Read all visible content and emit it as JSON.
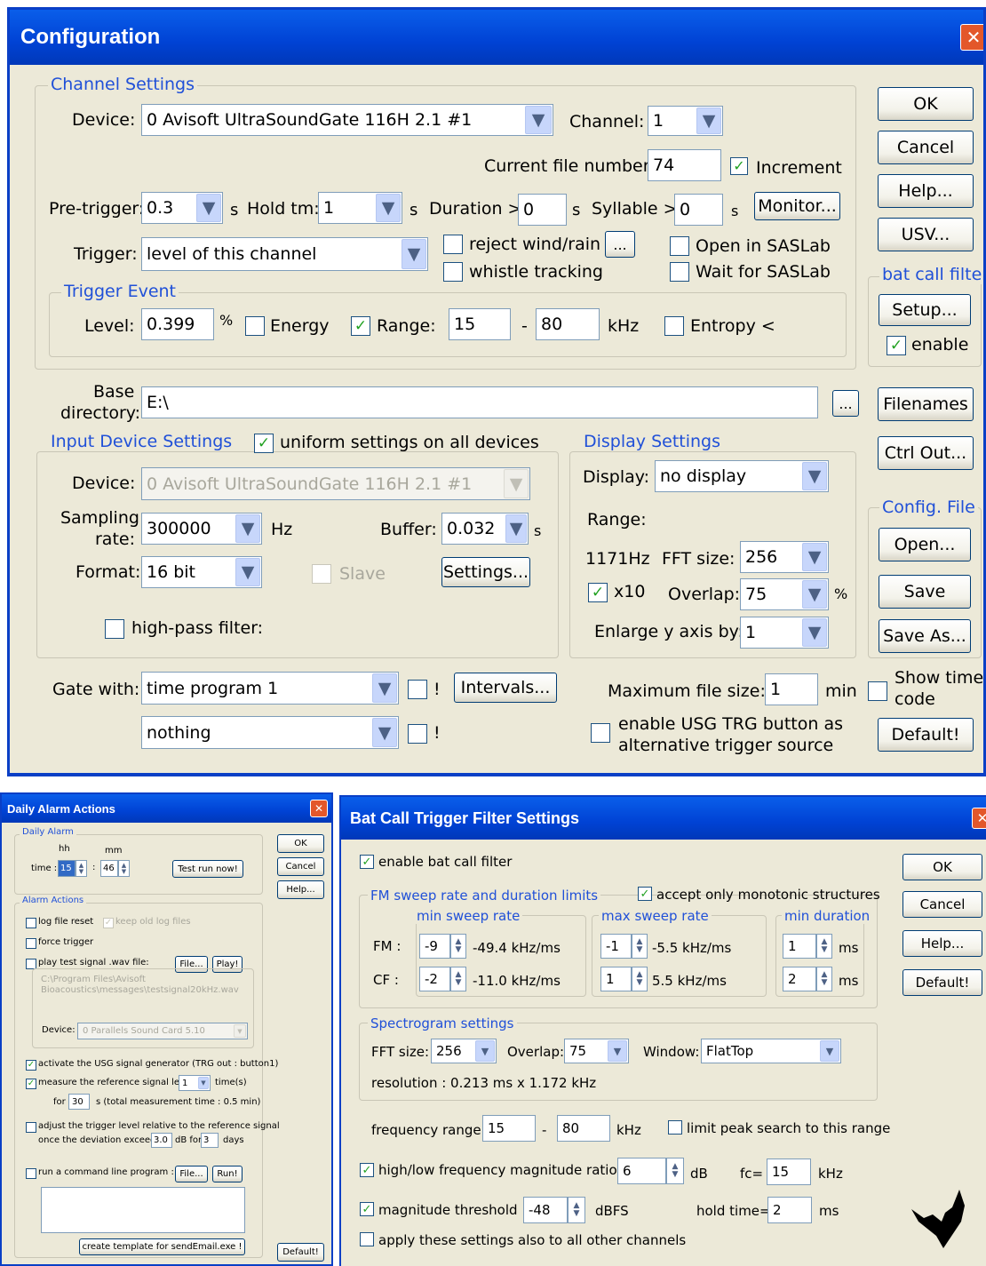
{
  "config": {
    "title": "Configuration",
    "close": "✕",
    "channel": {
      "legend": "Channel Settings",
      "device_label": "Device:",
      "device_value": "0 Avisoft UltraSoundGate 116H 2.1 #1",
      "channel_label": "Channel:",
      "channel_value": "1",
      "file_number_label": "Current file number:",
      "file_number_value": "74",
      "increment_label": "Increment",
      "pretrigger_label": "Pre-trigger:",
      "pretrigger_value": "0.3",
      "s": "s",
      "hold_label": "Hold tm:",
      "hold_value": "1",
      "duration_label": "Duration >",
      "duration_value": "0",
      "syllable_label": "Syllable >",
      "syllable_value": "0",
      "monitor_label": "Monitor...",
      "trigger_label": "Trigger:",
      "trigger_value": "level of this channel",
      "reject_label": "reject wind/rain",
      "dots": "...",
      "whistle_label": "whistle tracking",
      "open_saslab_label": "Open in SASLab",
      "wait_saslab_label": "Wait for SASLab"
    },
    "trigger_event": {
      "legend": "Trigger Event",
      "level_label": "Level:",
      "level_value": "0.399",
      "percent": "%",
      "energy_label": "Energy",
      "range_label": "Range:",
      "range_from": "15",
      "dash": "-",
      "range_to": "80",
      "khz": "kHz",
      "entropy_label": "Entropy <"
    },
    "base": {
      "label_line1": "Base",
      "label_line2": "directory:",
      "value": "E:\\",
      "dots": "..."
    },
    "input": {
      "legend": "Input Device Settings",
      "uniform_label": "uniform settings on all devices",
      "device_label": "Device:",
      "device_value": "0 Avisoft UltraSoundGate 116H 2.1 #1",
      "sampling_line1": "Sampling",
      "sampling_line2": "rate:",
      "sampling_value": "300000",
      "hz": "Hz",
      "buffer_label": "Buffer:",
      "buffer_value": "0.032",
      "s": "s",
      "format_label": "Format:",
      "format_value": "16 bit",
      "slave_label": "Slave",
      "settings_label": "Settings...",
      "highpass_label": "high-pass filter:"
    },
    "display": {
      "legend": "Display Settings",
      "display_label": "Display:",
      "display_value": "no display",
      "range_label": "Range:",
      "hz_value": "1171Hz",
      "fft_label": "FFT size:",
      "fft_value": "256",
      "x10_label": "x10",
      "overlap_label": "Overlap:",
      "overlap_value": "75",
      "percent": "%",
      "enlarge_label": "Enlarge y axis by:",
      "enlarge_value": "1"
    },
    "gate": {
      "label": "Gate with:",
      "value1": "time program 1",
      "excl": "!",
      "intervals_label": "Intervals...",
      "value2": "nothing",
      "max_size_label": "Maximum file size:",
      "max_size_value": "1",
      "min": "min",
      "usg_line1": "enable USG TRG button as",
      "usg_line2": "alternative trigger source",
      "show_time_line1": "Show time",
      "show_time_line2": "code"
    },
    "buttons": {
      "ok": "OK",
      "cancel": "Cancel",
      "help": "Help...",
      "usv": "USV...",
      "bat_legend": "bat call filter",
      "setup": "Setup...",
      "enable": "enable",
      "filenames": "Filenames",
      "ctrl_out": "Ctrl Out...",
      "config_legend": "Config. File",
      "open": "Open...",
      "save": "Save",
      "save_as": "Save As...",
      "default": "Default!"
    }
  },
  "alarm": {
    "title": "Daily Alarm Actions",
    "close": "✕",
    "daily_legend": "Daily Alarm",
    "hh": "hh",
    "mm": "mm",
    "time_label": "time :",
    "hh_value": "15",
    "colon": ":",
    "mm_value": "46",
    "test_run": "Test run now!",
    "ok": "OK",
    "cancel": "Cancel",
    "help": "Help...",
    "default": "Default!",
    "actions_legend": "Alarm Actions",
    "log_reset": "log file reset",
    "keep_logs": "keep old log files",
    "force_trigger": "force trigger",
    "play_test": "play test signal .wav file:",
    "file_btn": "File...",
    "play_btn": "Play!",
    "wav_path_line1": "C:\\Program Files\\Avisoft",
    "wav_path_line2": "Bioacoustics\\messages\\testsignal20kHz.wav",
    "device_label": "Device:",
    "device_value": "0 Parallels Sound Card 5.10",
    "activate_usg": "activate the USG signal generator (TRG out : button1)",
    "measure_label": "measure the reference signal level",
    "measure_value": "1",
    "times_label": "time(s)",
    "for_label": "for",
    "for_value": "30",
    "total_label": "s  (total measurement time : 0.5 min)",
    "adjust_line1": "adjust the trigger level relative to the reference signal",
    "adjust_line2": "once the deviation exceeds",
    "dev_value": "3.0",
    "db_for": "dB for",
    "days_value": "3",
    "days_label": "days",
    "run_cmd": "run a command line program :",
    "run_file": "File...",
    "run_btn": "Run!",
    "template_btn": "create template for sendEmail.exe !"
  },
  "bat": {
    "title": "Bat Call Trigger Filter Settings",
    "close": "✕",
    "enable_label": "enable bat call filter",
    "ok": "OK",
    "cancel": "Cancel",
    "help": "Help...",
    "default": "Default!",
    "fm_legend": "FM sweep rate and duration limits",
    "monotonic_label": "accept only monotonic structures",
    "min_sweep_legend": "min sweep rate",
    "max_sweep_legend": "max sweep rate",
    "min_dur_legend": "min duration",
    "fm_label": "FM :",
    "cf_label": "CF :",
    "fm_min": "-9",
    "fm_min_rate": "-49.4 kHz/ms",
    "fm_max": "-1",
    "fm_max_rate": "-5.5 kHz/ms",
    "fm_dur": "1",
    "cf_min": "-2",
    "cf_min_rate": "-11.0 kHz/ms",
    "cf_max": "1",
    "cf_max_rate": "5.5 kHz/ms",
    "cf_dur": "2",
    "ms": "ms",
    "spec_legend": "Spectrogram settings",
    "fft_label": "FFT size:",
    "fft_value": "256",
    "overlap_label": "Overlap:",
    "overlap_value": "75",
    "window_label": "Window:",
    "window_value": "FlatTop",
    "resolution": "resolution : 0.213 ms x 1.172 kHz",
    "freq_range_label": "frequency range:",
    "freq_from": "15",
    "dash": "-",
    "freq_to": "80",
    "khz": "kHz",
    "limit_peak_label": "limit peak search to this range",
    "ratio_label": "high/low frequency magnitude ratio >",
    "ratio_value": "6",
    "db": "dB",
    "fc_label": "fc=",
    "fc_value": "15",
    "fc_khz": "kHz",
    "mag_label": "magnitude threshold :",
    "mag_value": "-48",
    "dbfs": "dBFS",
    "hold_label": "hold time=",
    "hold_value": "2",
    "hold_ms": "ms",
    "apply_all_label": "apply these settings also to all other channels"
  }
}
